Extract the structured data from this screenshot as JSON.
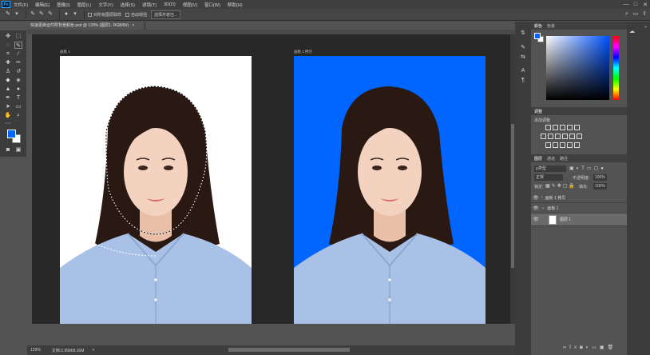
{
  "app": {
    "logo": "Ps"
  },
  "menu": [
    "文件(F)",
    "编辑(E)",
    "图像(I)",
    "图层(L)",
    "文字(Y)",
    "选择(S)",
    "滤镜(T)",
    "3D(D)",
    "视图(V)",
    "窗口(W)",
    "帮助(H)"
  ],
  "window_controls": {
    "minimize": "—",
    "restore": "□",
    "close": "✕"
  },
  "options_bar": {
    "sample_all": "对所有图层取样",
    "auto_enhance": "自动增强",
    "select_subject": "选择并遮住..."
  },
  "document": {
    "tab_title": "快速更换证件照背景颜色.psd @ 129% (图层1, RGB/8#)",
    "tab_close": "×",
    "artboard1": "画板 1",
    "artboard2": "画板 1 拷贝"
  },
  "status": {
    "zoom": "129%",
    "doc_size": "文档:2.95M/8.16M",
    "arrow": ">"
  },
  "color_panel": {
    "tabs": [
      "颜色",
      "色板"
    ],
    "foreground": "#0066ff",
    "background": "#ffffff"
  },
  "adjustments_panel": {
    "tab": "调整",
    "add_label": "添加调整"
  },
  "layers_panel": {
    "tabs": [
      "图层",
      "通道",
      "路径"
    ],
    "filter_kind": "ρ类型",
    "blend_mode": "正常",
    "opacity_label": "不透明度:",
    "opacity_value": "100%",
    "lock_label": "锁定:",
    "fill_label": "填充:",
    "fill_value": "100%",
    "layers": [
      {
        "name": "画板 1 拷贝",
        "type": "artboard",
        "expanded": false
      },
      {
        "name": "画板 1",
        "type": "artboard",
        "expanded": true
      },
      {
        "name": "图层 1",
        "type": "layer",
        "selected": true
      }
    ]
  }
}
